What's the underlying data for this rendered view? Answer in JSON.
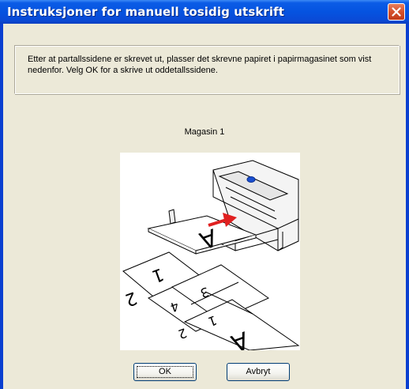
{
  "window": {
    "title": "Instruksjoner for manuell tosidig utskrift"
  },
  "message": "Etter at partallssidene er skrevet ut, plasser det skrevne papiret i papirmagasinet som vist nedenfor. Velg OK for a skrive ut oddetallssidene.",
  "caption": "Magasin 1",
  "illustration": {
    "labels": [
      "A",
      "1",
      "2",
      "3",
      "4",
      "1",
      "2",
      "A"
    ]
  },
  "buttons": {
    "ok": "OK",
    "cancel": "Avbryt"
  },
  "colors": {
    "titlebar": "#0553e0",
    "close_button": "#d5502b",
    "dialog_background": "#ece9d8",
    "arrow": "#e02020"
  },
  "icons": {
    "close": "close-icon"
  }
}
